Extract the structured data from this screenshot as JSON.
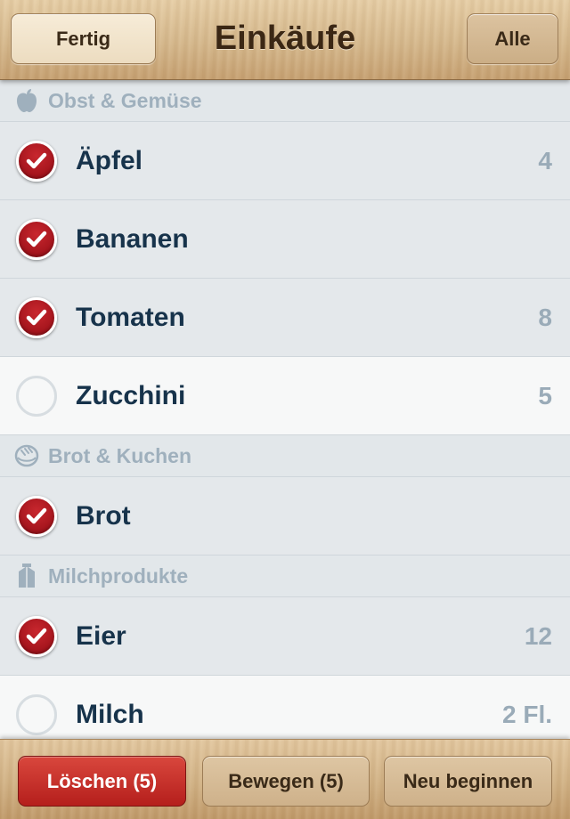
{
  "navbar": {
    "left_button": "Fertig",
    "title": "Einkäufe",
    "right_button": "Alle"
  },
  "sections": [
    {
      "title": "Obst & Gemüse",
      "icon": "apple-icon",
      "items": [
        {
          "name": "Äpfel",
          "qty": "4",
          "checked": true
        },
        {
          "name": "Bananen",
          "qty": "",
          "checked": true
        },
        {
          "name": "Tomaten",
          "qty": "8",
          "checked": true
        },
        {
          "name": "Zucchini",
          "qty": "5",
          "checked": false
        }
      ]
    },
    {
      "title": "Brot & Kuchen",
      "icon": "bread-icon",
      "items": [
        {
          "name": "Brot",
          "qty": "",
          "checked": true
        }
      ]
    },
    {
      "title": "Milchprodukte",
      "icon": "milk-carton-icon",
      "items": [
        {
          "name": "Eier",
          "qty": "12",
          "checked": true
        },
        {
          "name": "Milch",
          "qty": "2 Fl.",
          "checked": false
        }
      ]
    }
  ],
  "toolbar": {
    "delete_label": "Löschen (5)",
    "move_label": "Bewegen (5)",
    "restart_label": "Neu beginnen"
  },
  "colors": {
    "check_red": "#b51f1c",
    "item_text": "#17334b",
    "section_text": "#9fb0bd"
  }
}
